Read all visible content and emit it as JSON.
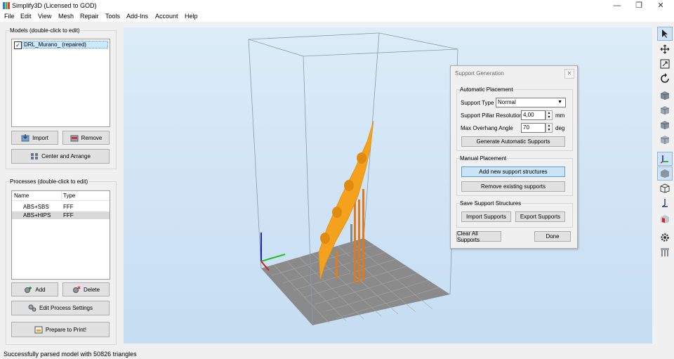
{
  "window": {
    "title": "Simplify3D (Licensed to GOD)",
    "minimize": "—",
    "maximize": "❐",
    "close": "✕"
  },
  "menu": [
    "File",
    "Edit",
    "View",
    "Mesh",
    "Repair",
    "Tools",
    "Add-Ins",
    "Account",
    "Help"
  ],
  "models": {
    "group_title": "Models (double-click to edit)",
    "items": [
      {
        "name": "DRL_Murano_ (repaired)",
        "checked": true
      }
    ],
    "import_label": "Import",
    "remove_label": "Remove",
    "center_label": "Center and Arrange"
  },
  "processes": {
    "group_title": "Processes (double-click to edit)",
    "columns": [
      "Name",
      "Type"
    ],
    "rows": [
      {
        "name": "ABS+SBS",
        "type": "FFF"
      },
      {
        "name": "ABS+HIPS",
        "type": "FFF"
      }
    ],
    "add_label": "Add",
    "delete_label": "Delete",
    "edit_label": "Edit Process Settings"
  },
  "prepare_label": "Prepare to Print!",
  "status": "Successfully parsed model with 50826 triangles",
  "support_dialog": {
    "title": "Support Generation",
    "auto_group": "Automatic Placement",
    "support_type_label": "Support Type",
    "support_type_value": "Normal",
    "pillar_label": "Support Pillar Resolution",
    "pillar_value": "4,00",
    "pillar_unit": "mm",
    "overhang_label": "Max Overhang Angle",
    "overhang_value": "70",
    "overhang_unit": "deg",
    "generate_label": "Generate Automatic Supports",
    "manual_group": "Manual Placement",
    "add_label": "Add new support structures",
    "remove_label": "Remove existing supports",
    "save_group": "Save Support Structures",
    "import_label": "Import Supports",
    "export_label": "Export Supports",
    "clear_label": "Clear All Supports",
    "done_label": "Done"
  },
  "toolbar_icons": [
    "select-arrow-icon",
    "move-icon",
    "scale-icon",
    "rotate-icon",
    "cube-view-icon",
    "cube-front-icon",
    "cube-side-icon",
    "cube-top-icon",
    "axes-icon",
    "cube-shaded-icon",
    "cube-wireframe-icon",
    "cross-section-icon",
    "cube-red-icon",
    "gear-icon",
    "support-pillars-icon"
  ],
  "colors": {
    "model": "#f4a21d",
    "supports": "#e07a1a",
    "accent": "#0078d7"
  }
}
